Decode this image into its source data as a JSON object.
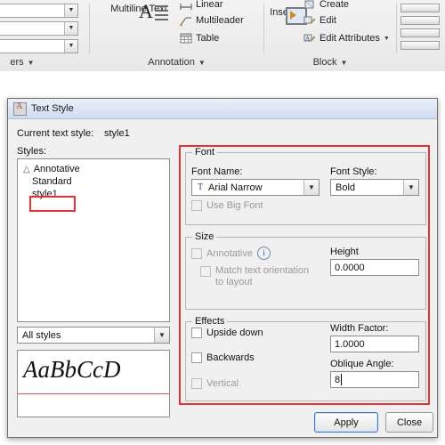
{
  "ribbon": {
    "panels": [
      {
        "title": "Annotation",
        "arrow": "▼"
      },
      {
        "title": "Block",
        "arrow": "▼"
      }
    ],
    "left_panel_title": "ers",
    "left_panel_arrow": "▼",
    "buttons": {
      "multiline_text": "Multiline Text",
      "multileader": "Multileader",
      "table": "Table",
      "insert": "Insert",
      "linear": "Linear",
      "create": "Create",
      "edit": "Edit",
      "edit_attributes": "Edit Attributes",
      "edit_attributes_arrow": "▼"
    }
  },
  "dialog": {
    "title": "Text Style",
    "current_style_label": "Current text style:",
    "current_style_value": "style1",
    "styles_label": "Styles:",
    "styles": [
      {
        "name": "Annotative",
        "annotative": true,
        "selected": false
      },
      {
        "name": "Standard",
        "annotative": false,
        "selected": false
      },
      {
        "name": "style1",
        "annotative": false,
        "selected": true
      }
    ],
    "filter_value": "All styles",
    "filter_arrow": "▼",
    "preview_text": "AaBbCcD",
    "font": {
      "group_label": "Font",
      "name_label": "Font Name:",
      "name_value": "Arial Narrow",
      "name_icon": "T",
      "style_label": "Font Style:",
      "style_value": "Bold",
      "use_big_font_label": "Use Big Font",
      "use_big_font_checked": false,
      "arrow": "▼"
    },
    "size": {
      "group_label": "Size",
      "annotative_label": "Annotative",
      "annotative_checked": false,
      "match_label_line1": "Match text orientation",
      "match_label_line2": "to layout",
      "match_checked": false,
      "height_label": "Height",
      "height_value": "0.0000"
    },
    "effects": {
      "group_label": "Effects",
      "upside_down_label": "Upside down",
      "upside_down_checked": false,
      "backwards_label": "Backwards",
      "backwards_checked": false,
      "vertical_label": "Vertical",
      "vertical_checked": false,
      "width_factor_label": "Width Factor:",
      "width_factor_value": "1.0000",
      "oblique_angle_label": "Oblique Angle:",
      "oblique_angle_value": "8"
    },
    "buttons": {
      "apply": "Apply",
      "close": "Close"
    },
    "highlight_color": "#e53333"
  }
}
